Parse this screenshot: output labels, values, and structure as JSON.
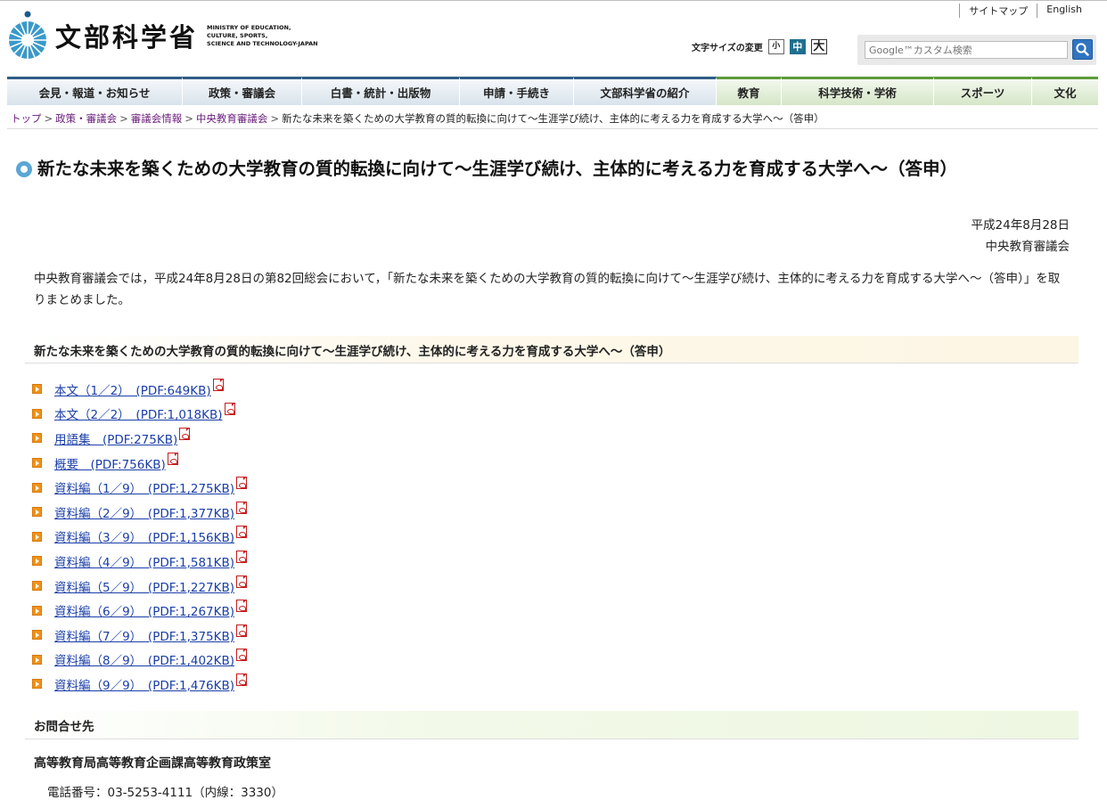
{
  "header": {
    "logo_jp": "文部科学省",
    "logo_en_lines": [
      "MINISTRY OF EDUCATION,",
      "CULTURE, SPORTS,",
      "SCIENCE AND TECHNOLOGY-JAPAN"
    ],
    "links": [
      "サイトマップ",
      "English"
    ],
    "font_size_label": "文字サイズの変更",
    "font_sizes": [
      "小",
      "中",
      "大"
    ],
    "search_placeholder": "Google™カスタム検索"
  },
  "nav": {
    "items": [
      "会見・報道・お知らせ",
      "政策・審議会",
      "白書・統計・出版物",
      "申請・手続き",
      "文部科学省の紹介",
      "教育",
      "科学技術・学術",
      "スポーツ",
      "文化"
    ]
  },
  "breadcrumb": {
    "items": [
      "トップ",
      "政策・審議会",
      "審議会情報",
      "中央教育審議会"
    ],
    "current": "新たな未来を築くための大学教育の質的転換に向けて～生涯学び続け、主体的に考える力を育成する大学へ～（答申）",
    "separator": ">"
  },
  "page": {
    "title": "新たな未来を築くための大学教育の質的転換に向けて～生涯学び続け、主体的に考える力を育成する大学へ～（答申）",
    "date": "平成24年8月28日",
    "org": "中央教育審議会",
    "intro": "中央教育審議会では，平成24年8月28日の第82回総会において，「新たな未来を築くための大学教育の質的転換に向けて～生涯学び続け、主体的に考える力を育成する大学へ～（答申）」を取りまとめました。"
  },
  "documents": {
    "heading": "新たな未来を築くための大学教育の質的転換に向けて～生涯学び続け、主体的に考える力を育成する大学へ～（答申）",
    "items": [
      "本文（1／2）　(PDF:649KB)",
      "本文（2／2）　(PDF:1,018KB)",
      "用語集　(PDF:275KB)",
      "概要　(PDF:756KB)",
      "資料編（1／9）　(PDF:1,275KB)",
      "資料編（2／9）　(PDF:1,377KB)",
      "資料編（3／9）　(PDF:1,156KB)",
      "資料編（4／9）　(PDF:1,581KB)",
      "資料編（5／9）　(PDF:1,227KB)",
      "資料編（6／9）　(PDF:1,267KB)",
      "資料編（7／9）　(PDF:1,375KB)",
      "資料編（8／9）　(PDF:1,402KB)",
      "資料編（9／9）　(PDF:1,476KB)"
    ]
  },
  "contact": {
    "heading": "お問合せ先",
    "department": "高等教育局高等教育企画課高等教育政策室",
    "phone": "電話番号：03-5253-4111（内線：3330）"
  }
}
